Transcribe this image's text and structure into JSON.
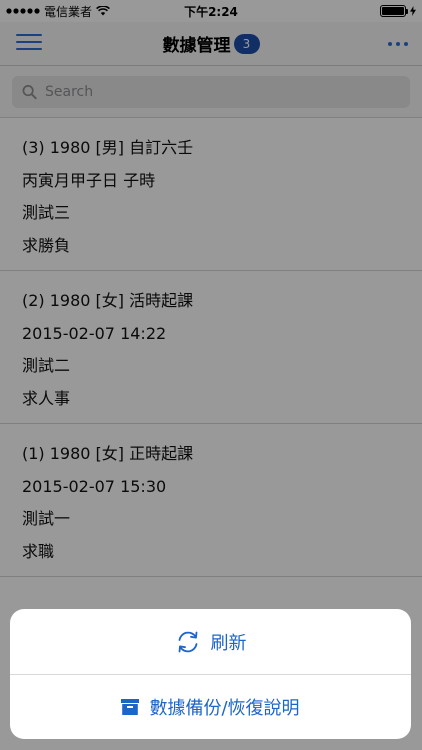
{
  "status_bar": {
    "carrier": "電信業者",
    "time": "下午2:24"
  },
  "nav": {
    "title": "數據管理",
    "badge": "3"
  },
  "search": {
    "placeholder": "Search"
  },
  "records": [
    {
      "lines": [
        "(3) 1980 [男] 自訂六壬",
        "丙寅月甲子日 子時",
        "測試三",
        "求勝負"
      ]
    },
    {
      "lines": [
        "(2) 1980 [女] 活時起課",
        "2015-02-07 14:22",
        "測試二",
        "求人事"
      ]
    },
    {
      "lines": [
        "(1) 1980 [女] 正時起課",
        "2015-02-07 15:30",
        "測試一",
        "求職"
      ]
    }
  ],
  "action_sheet": {
    "refresh_label": "刷新",
    "backup_label": "數據備份/恢復說明"
  },
  "colors": {
    "accent": "#1d66c9",
    "badge": "#1e4fa8"
  }
}
